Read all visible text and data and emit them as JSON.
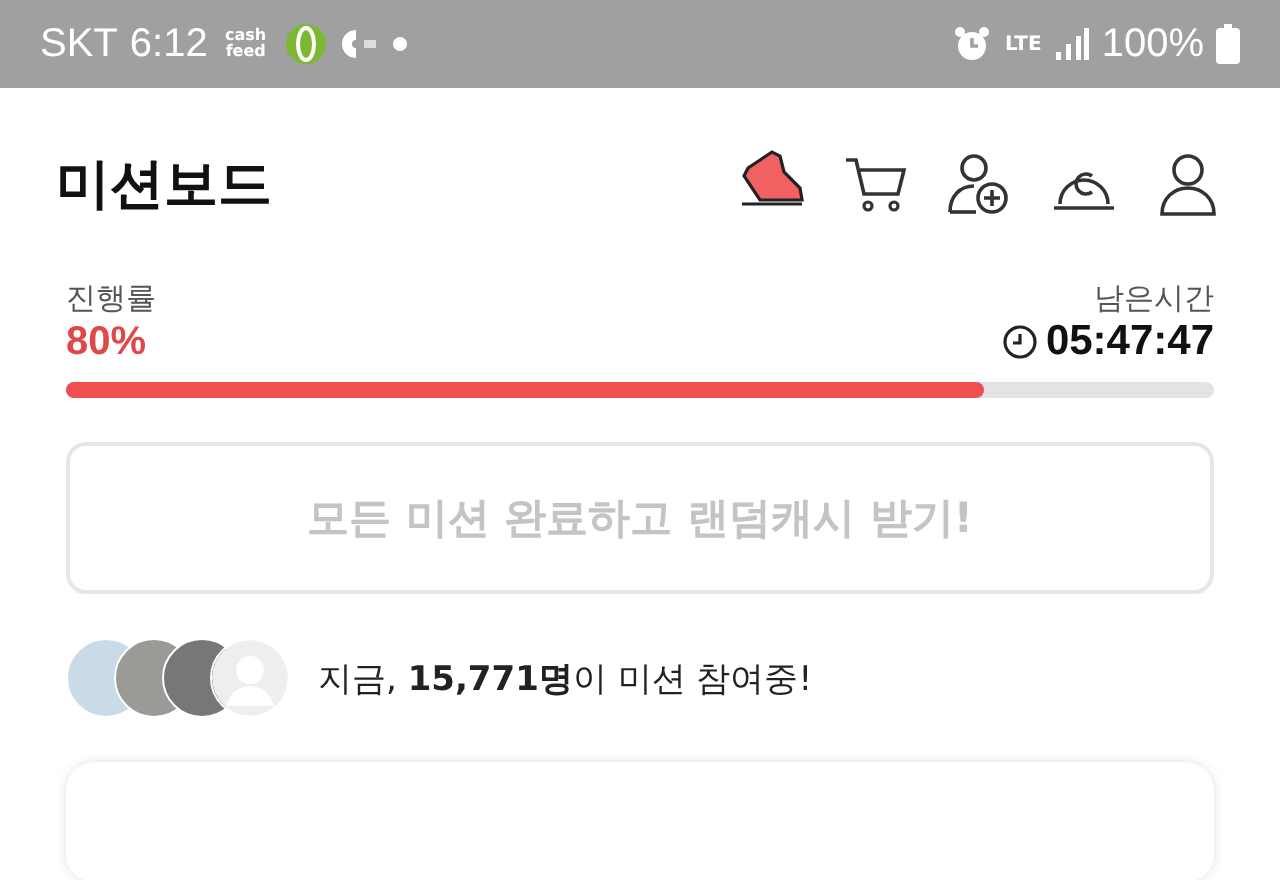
{
  "status_bar": {
    "carrier": "SKT",
    "time": "6:12",
    "app_label": "cash feed",
    "network": "LTE",
    "battery": "100%"
  },
  "header": {
    "title": "미션보드"
  },
  "progress": {
    "label": "진행률",
    "value": "80%",
    "level": 0.8,
    "remaining_label": "남은시간",
    "remaining": "05:47:47"
  },
  "claim_button": {
    "label": "모든 미션 완료하고 랜덤캐시 받기!",
    "disabled": true
  },
  "participants": {
    "avatars": [
      {
        "kind": "photo"
      },
      {
        "kind": "photo"
      },
      {
        "kind": "photo"
      },
      {
        "kind": "default"
      }
    ],
    "text": "지금, **15,771명**이 미션 참여중!"
  }
}
